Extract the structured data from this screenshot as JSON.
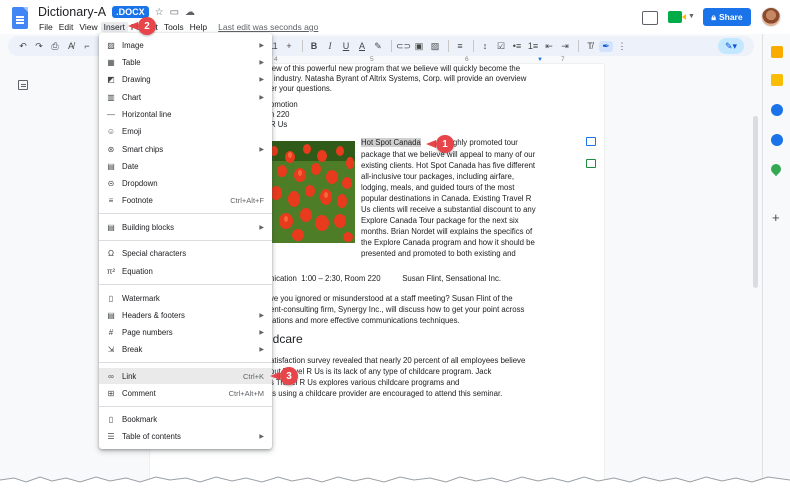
{
  "header": {
    "doc_title": "Dictionary-A",
    "badge": ".DOCX",
    "menu": [
      "File",
      "Edit",
      "View",
      "Insert",
      "Format",
      "Tools",
      "Help"
    ],
    "active_menu": "Insert",
    "last_edit": "Last edit was seconds ago",
    "share_label": "Share"
  },
  "toolbar": {
    "font_size": "11"
  },
  "ruler": {
    "marks": [
      "4",
      "5",
      "6",
      "7"
    ]
  },
  "insert_menu": {
    "items": [
      {
        "icon": "image-icon",
        "label": "Image",
        "submenu": true
      },
      {
        "icon": "table-icon",
        "label": "Table",
        "submenu": true
      },
      {
        "icon": "drawing-icon",
        "label": "Drawing",
        "submenu": true
      },
      {
        "icon": "chart-icon",
        "label": "Chart",
        "submenu": true
      },
      {
        "icon": "horizontal-line-icon",
        "label": "Horizontal line"
      },
      {
        "icon": "emoji-icon",
        "label": "Emoji"
      },
      {
        "icon": "smart-chips-icon",
        "label": "Smart chips",
        "submenu": true
      },
      {
        "icon": "date-icon",
        "label": "Date"
      },
      {
        "icon": "dropdown-icon",
        "label": "Dropdown"
      },
      {
        "icon": "footnote-icon",
        "label": "Footnote",
        "shortcut": "Ctrl+Alt+F"
      },
      {
        "icon": "building-blocks-icon",
        "label": "Building blocks",
        "submenu": true
      },
      {
        "icon": "special-characters-icon",
        "label": "Special characters"
      },
      {
        "icon": "equation-icon",
        "label": "Equation"
      },
      {
        "icon": "watermark-icon",
        "label": "Watermark"
      },
      {
        "icon": "headers-footers-icon",
        "label": "Headers & footers",
        "submenu": true
      },
      {
        "icon": "page-numbers-icon",
        "label": "Page numbers",
        "submenu": true
      },
      {
        "icon": "break-icon",
        "label": "Break",
        "submenu": true
      },
      {
        "icon": "link-icon",
        "label": "Link",
        "shortcut": "Ctrl+K"
      },
      {
        "icon": "comment-icon",
        "label": "Comment",
        "shortcut": "Ctrl+Alt+M"
      },
      {
        "icon": "bookmark-icon",
        "label": "Bookmark"
      },
      {
        "icon": "table-of-contents-icon",
        "label": "Table of contents",
        "submenu": true
      }
    ]
  },
  "document": {
    "intro_lines": [
      "iew of this powerful new program that we believe will quickly become the",
      "l industry. Natasha Byrant of Altrix Systems, Corp. will provide an overview",
      "er your questions."
    ],
    "session_lines": [
      "omotion",
      "n 220",
      "R Us"
    ],
    "highlight_text": "Hot Spot Canada",
    "para_first_line_rest": "highly promoted tour",
    "para_lines": [
      "package that we believe will appeal to many of our",
      "existing clients. Hot Spot Canada has five different",
      "all-inclusive tour packages, including airfare,",
      "lodging, meals, and guided tours of the most",
      "popular destinations in Canada. Existing Travel R",
      "Us clients will receive a substantial discount to any",
      "Explore Canada Tour package for the next six",
      "months. Brian Nordet will explains the specifics of",
      "the Explore Canada program and how it should be",
      "presented and promoted to both existing and"
    ],
    "session2_line": "nication  1:00 – 2:30, Room 220          Susan Flint, Sensational Inc.",
    "session2_desc": [
      "ve you ignored or misunderstood at a staff meeting? Susan Flint of the",
      "ent-consulting firm, Synergy Inc., will discuss how to get your point across",
      "tations and more effective communications techniques."
    ],
    "heading": "ldcare",
    "childcare_lines": [
      "atisfaction survey revealed that nearly 20 percent of all employees believe",
      "out Travel R Us is its lack of any type of childcare program. Jack",
      "s Travel R Us explores various childcare programs and",
      "ts using a childcare provider are encouraged to attend this seminar."
    ]
  },
  "callouts": [
    "1",
    "2",
    "3"
  ],
  "colors": {
    "accent": "#1a73e8",
    "callout": "#e8454a",
    "menu_hover": "#eaeaea"
  }
}
